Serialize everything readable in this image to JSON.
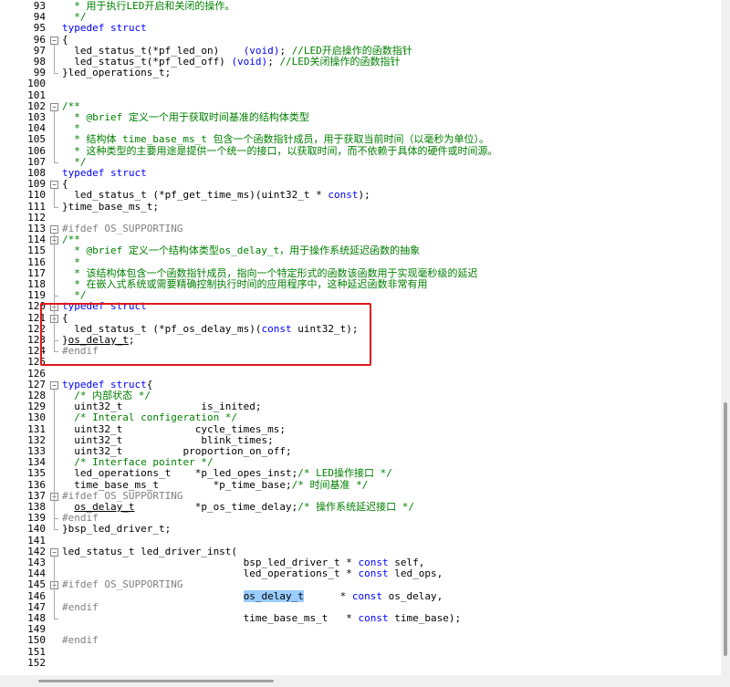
{
  "editor": {
    "lines": [
      {
        "n": "93",
        "segs": [
          {
            "t": "  * 用于执行LED开启和关闭的操作。",
            "c": "cm"
          }
        ]
      },
      {
        "n": "94",
        "segs": [
          {
            "t": "  */",
            "c": "cm"
          }
        ]
      },
      {
        "n": "95",
        "segs": [
          {
            "t": "typedef struct",
            "c": "kw"
          }
        ]
      },
      {
        "n": "96",
        "segs": [
          {
            "t": "{",
            "c": ""
          }
        ]
      },
      {
        "n": "97",
        "segs": [
          {
            "t": "  led_status_t(*pf_led_on)    ",
            "c": ""
          },
          {
            "t": "(void)",
            "c": "kw"
          },
          {
            "t": "; ",
            "c": ""
          },
          {
            "t": "//LED开启操作的函数指针",
            "c": "cm"
          }
        ]
      },
      {
        "n": "98",
        "segs": [
          {
            "t": "  led_status_t(*pf_led_off) ",
            "c": ""
          },
          {
            "t": "(void)",
            "c": "kw"
          },
          {
            "t": "; ",
            "c": ""
          },
          {
            "t": "//LED关闭操作的函数指针",
            "c": "cm"
          }
        ]
      },
      {
        "n": "99",
        "segs": [
          {
            "t": "}led_operations_t;",
            "c": ""
          }
        ]
      },
      {
        "n": "100",
        "segs": []
      },
      {
        "n": "101",
        "segs": []
      },
      {
        "n": "102",
        "segs": [
          {
            "t": "/**",
            "c": "cm"
          }
        ]
      },
      {
        "n": "103",
        "segs": [
          {
            "t": "  * @brief 定义一个用于获取时间基准的结构体类型",
            "c": "cm"
          }
        ]
      },
      {
        "n": "104",
        "segs": [
          {
            "t": "  *",
            "c": "cm"
          }
        ]
      },
      {
        "n": "105",
        "segs": [
          {
            "t": "  * 结构体 time_base_ms_t 包含一个函数指针成员，用于获取当前时间（以毫秒为单位）。",
            "c": "cm"
          }
        ]
      },
      {
        "n": "106",
        "segs": [
          {
            "t": "  * 这种类型的主要用途是提供一个统一的接口，以获取时间，而不依赖于具体的硬件或时间源。",
            "c": "cm"
          }
        ]
      },
      {
        "n": "107",
        "segs": [
          {
            "t": "  */",
            "c": "cm"
          }
        ]
      },
      {
        "n": "108",
        "segs": [
          {
            "t": "typedef struct",
            "c": "kw"
          }
        ]
      },
      {
        "n": "109",
        "segs": [
          {
            "t": "{",
            "c": ""
          }
        ]
      },
      {
        "n": "110",
        "segs": [
          {
            "t": "  led_status_t (*pf_get_time_ms)(uint32_t * ",
            "c": ""
          },
          {
            "t": "const",
            "c": "kw"
          },
          {
            "t": ");",
            "c": ""
          }
        ]
      },
      {
        "n": "111",
        "segs": [
          {
            "t": "}time_base_ms_t;",
            "c": ""
          }
        ]
      },
      {
        "n": "112",
        "segs": []
      },
      {
        "n": "113",
        "segs": [
          {
            "t": "#ifdef OS_SUPPORTING",
            "c": "pp"
          }
        ]
      },
      {
        "n": "114",
        "segs": [
          {
            "t": "/**",
            "c": "cm"
          }
        ]
      },
      {
        "n": "115",
        "segs": [
          {
            "t": "  * @brief 定义一个结构体类型os_delay_t，用于操作系统延迟函数的抽象",
            "c": "cm"
          }
        ]
      },
      {
        "n": "116",
        "segs": [
          {
            "t": "  *",
            "c": "cm"
          }
        ]
      },
      {
        "n": "117",
        "segs": [
          {
            "t": "  * 该结构体包含一个函数指针成员，指向一个特定形式的函数该函数用于实现毫秒级的延迟",
            "c": "cm"
          }
        ]
      },
      {
        "n": "118",
        "segs": [
          {
            "t": "  * 在嵌入式系统或需要精确控制执行时间的应用程序中，这种延迟函数非常有用",
            "c": "cm"
          }
        ]
      },
      {
        "n": "119",
        "segs": [
          {
            "t": "  */",
            "c": "cm"
          }
        ]
      },
      {
        "n": "120",
        "segs": [
          {
            "t": "typedef struct",
            "c": "kw"
          }
        ]
      },
      {
        "n": "121",
        "segs": [
          {
            "t": "{",
            "c": ""
          }
        ]
      },
      {
        "n": "122",
        "segs": [
          {
            "t": "  led_status_t (*pf_os_delay_ms)(",
            "c": ""
          },
          {
            "t": "const",
            "c": "kw"
          },
          {
            "t": " uint32_t);",
            "c": ""
          }
        ]
      },
      {
        "n": "123",
        "segs": [
          {
            "t": "}",
            "c": ""
          },
          {
            "t": "os_delay_t",
            "c": "ul"
          },
          {
            "t": ";",
            "c": ""
          }
        ]
      },
      {
        "n": "124",
        "segs": [
          {
            "t": "#endif",
            "c": "pp"
          }
        ]
      },
      {
        "n": "125",
        "segs": []
      },
      {
        "n": "126",
        "segs": []
      },
      {
        "n": "127",
        "segs": [
          {
            "t": "typedef struct",
            "c": "kw"
          },
          {
            "t": "{",
            "c": ""
          }
        ]
      },
      {
        "n": "128",
        "segs": [
          {
            "t": "  /* 内部状态 */",
            "c": "cm"
          }
        ]
      },
      {
        "n": "129",
        "segs": [
          {
            "t": "  uint32_t             is_inited;",
            "c": ""
          }
        ]
      },
      {
        "n": "130",
        "segs": [
          {
            "t": "  /* Interal configeration */",
            "c": "cm"
          }
        ]
      },
      {
        "n": "131",
        "segs": [
          {
            "t": "  uint32_t            cycle_times_ms;",
            "c": ""
          }
        ]
      },
      {
        "n": "132",
        "segs": [
          {
            "t": "  uint32_t             blink_times;",
            "c": ""
          }
        ]
      },
      {
        "n": "133",
        "segs": [
          {
            "t": "  uint32_t          proportion_on_off;",
            "c": ""
          }
        ]
      },
      {
        "n": "134",
        "segs": [
          {
            "t": "  /* Interface pointer */",
            "c": "cm"
          }
        ]
      },
      {
        "n": "135",
        "segs": [
          {
            "t": "  led_operations_t    *p_led_opes_inst;",
            "c": ""
          },
          {
            "t": "/* LED操作接口 */",
            "c": "cm"
          }
        ]
      },
      {
        "n": "136",
        "segs": [
          {
            "t": "  time_base_ms_t         *p_time_base;",
            "c": ""
          },
          {
            "t": "/* 时间基准 */",
            "c": "cm"
          }
        ]
      },
      {
        "n": "137",
        "segs": [
          {
            "t": "#ifdef OS_SUPPORTING",
            "c": "pp"
          }
        ]
      },
      {
        "n": "138",
        "segs": [
          {
            "t": "  ",
            "c": ""
          },
          {
            "t": "os_delay_t",
            "c": "ul"
          },
          {
            "t": "          *p_os_time_delay;",
            "c": ""
          },
          {
            "t": "/* 操作系统延迟接口 */",
            "c": "cm"
          }
        ]
      },
      {
        "n": "139",
        "segs": [
          {
            "t": "#endif",
            "c": "pp"
          }
        ]
      },
      {
        "n": "140",
        "segs": [
          {
            "t": "}bsp_led_driver_t;",
            "c": ""
          }
        ]
      },
      {
        "n": "141",
        "segs": []
      },
      {
        "n": "142",
        "segs": [
          {
            "t": "led_status_t led_driver_inst(",
            "c": ""
          }
        ]
      },
      {
        "n": "143",
        "segs": [
          {
            "t": "                              bsp_led_driver_t * ",
            "c": ""
          },
          {
            "t": "const",
            "c": "kw"
          },
          {
            "t": " self,",
            "c": ""
          }
        ]
      },
      {
        "n": "144",
        "segs": [
          {
            "t": "                              led_operations_t * ",
            "c": ""
          },
          {
            "t": "const",
            "c": "kw"
          },
          {
            "t": " led_ops,",
            "c": ""
          }
        ]
      },
      {
        "n": "145",
        "segs": [
          {
            "t": "#ifdef OS_SUPPORTING",
            "c": "pp"
          }
        ]
      },
      {
        "n": "146",
        "segs": [
          {
            "t": "                              ",
            "c": ""
          },
          {
            "t": "os_delay_t",
            "c": "hl"
          },
          {
            "t": "      * ",
            "c": ""
          },
          {
            "t": "const",
            "c": "kw"
          },
          {
            "t": " os_delay,",
            "c": ""
          }
        ]
      },
      {
        "n": "147",
        "segs": [
          {
            "t": "#endif",
            "c": "pp"
          }
        ]
      },
      {
        "n": "148",
        "segs": [
          {
            "t": "                              time_base_ms_t   * ",
            "c": ""
          },
          {
            "t": "const",
            "c": "kw"
          },
          {
            "t": " time_base);",
            "c": ""
          }
        ]
      },
      {
        "n": "149",
        "segs": []
      },
      {
        "n": "150",
        "segs": [
          {
            "t": "#endif",
            "c": "pp"
          }
        ]
      },
      {
        "n": "151",
        "segs": []
      },
      {
        "n": "152",
        "segs": []
      }
    ]
  },
  "annotation": {
    "color": "#e0181a",
    "label": ""
  },
  "colors": {
    "keyword": "#0000ff",
    "comment": "#008000",
    "preprocessor": "#808080",
    "selection": "#99ccff"
  }
}
